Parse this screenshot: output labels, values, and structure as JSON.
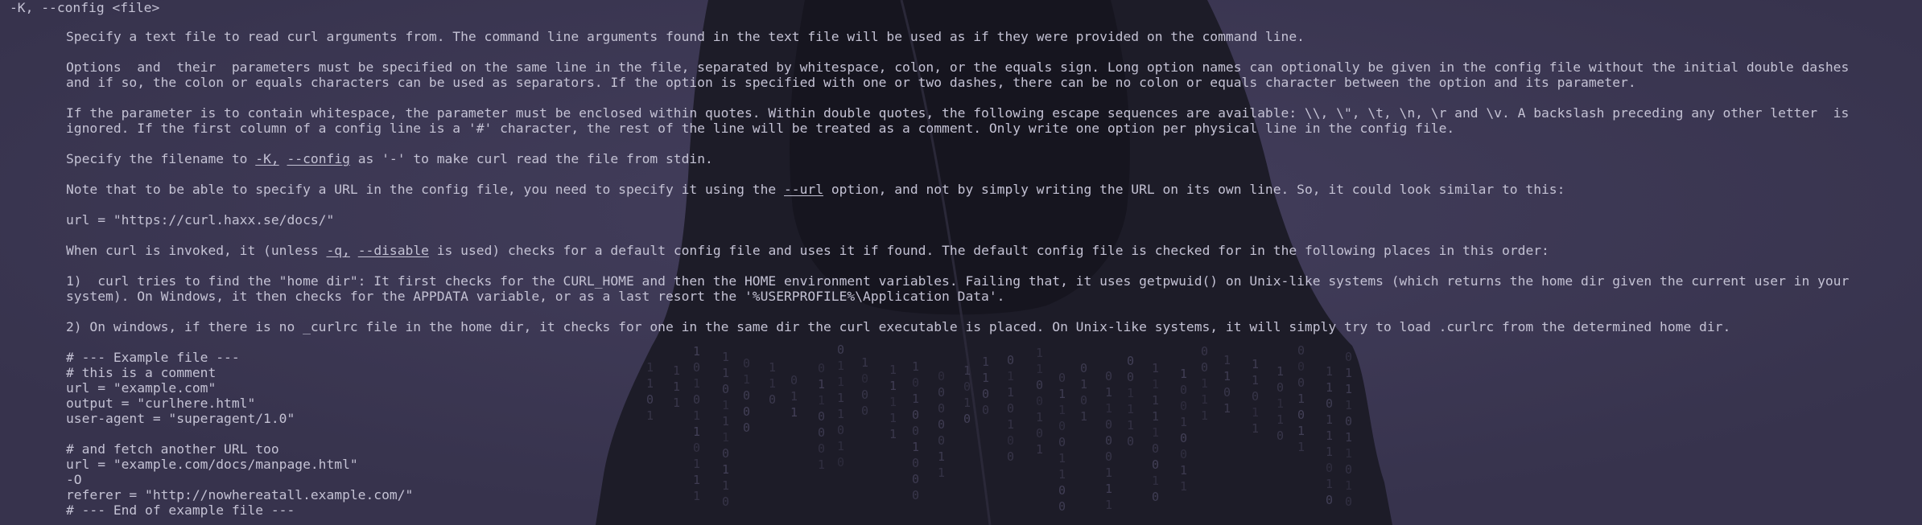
{
  "option_heading": "-K, --config <file>",
  "paragraphs": {
    "p1": "Specify a text file to read curl arguments from. The command line arguments found in the text file will be used as if they were provided on the command line.",
    "p2a": "Options  and  their  parameters must be specified on the same line in the file, separated by whitespace, colon, or the equals sign. Long option names can optionally be given in the config file without the initial double dashes",
    "p2b": "and if so, the colon or equals characters can be used as separators. If the option is specified with one or two dashes, there can be no colon or equals character between the option and its parameter.",
    "p3a": "If the parameter is to contain whitespace, the parameter must be enclosed within quotes. Within double quotes, the following escape sequences are available: \\\\, \\\", \\t, \\n, \\r and \\v. A backslash preceding any other letter  is",
    "p3b": "ignored. If the first column of a config line is a '#' character, the rest of the line will be treated as a comment. Only write one option per physical line in the config file.",
    "p4_pre": "Specify the filename to ",
    "p4_link1": "-K,",
    "p4_sp": " ",
    "p4_link2": "--config",
    "p4_post": " as '-' to make curl read the file from stdin.",
    "p5_pre": "Note that to be able to specify a URL in the config file, you need to specify it using the ",
    "p5_link": "--url",
    "p5_post": " option, and not by simply writing the URL on its own line. So, it could look similar to this:",
    "p6": "url = \"https://curl.haxx.se/docs/\"",
    "p7_pre": "When curl is invoked, it (unless ",
    "p7_link1": "-q,",
    "p7_sp": " ",
    "p7_link2": "--disable",
    "p7_post": " is used) checks for a default config file and uses it if found. The default config file is checked for in the following places in this order:",
    "p8a": "1)  curl tries to find the \"home dir\": It first checks for the CURL_HOME and then the HOME environment variables. Failing that, it uses getpwuid() on Unix-like systems (which returns the home dir given the current user in your",
    "p8b": "system). On Windows, it then checks for the APPDATA variable, or as a last resort the '%USERPROFILE%\\Application Data'.",
    "p9": "2) On windows, if there is no _curlrc file in the home dir, it checks for one in the same dir the curl executable is placed. On Unix-like systems, it will simply try to load .curlrc from the determined home dir."
  },
  "example": [
    "# --- Example file ---",
    "# this is a comment",
    "url = \"example.com\"",
    "output = \"curlhere.html\"",
    "user-agent = \"superagent/1.0\"",
    "",
    "# and fetch another URL too",
    "url = \"example.com/docs/manpage.html\"",
    "-O",
    "referer = \"http://nowhereatall.example.com/\"",
    "# --- End of example file ---"
  ],
  "colors": {
    "background": "#3b3752",
    "text": "#c4c2d4",
    "silhouette": "#1c1b27"
  }
}
